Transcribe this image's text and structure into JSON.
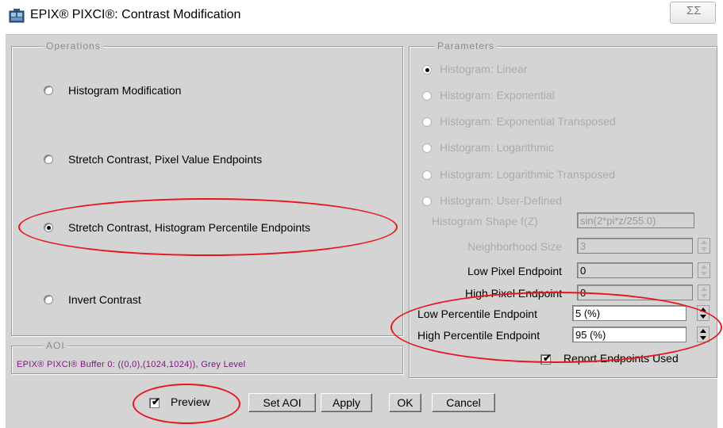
{
  "window": {
    "title": "EPIX® PIXCI®: Contrast Modification",
    "close_glyph": "☒",
    "close_symbol": "ΣΣ"
  },
  "operations": {
    "legend": "Operations",
    "options": [
      {
        "label": "Histogram Modification",
        "selected": false
      },
      {
        "label": "Stretch Contrast, Pixel Value Endpoints",
        "selected": false
      },
      {
        "label": "Stretch Contrast, Histogram Percentile Endpoints",
        "selected": true
      },
      {
        "label": "Invert Contrast",
        "selected": false
      }
    ]
  },
  "aoi": {
    "legend": "AOI",
    "text": "EPIX® PIXCI® Buffer 0: ((0,0),(1024,1024)), Grey Level"
  },
  "parameters": {
    "legend": "Parameters",
    "histogram_options": [
      {
        "label": "Histogram: Linear",
        "selected": true
      },
      {
        "label": "Histogram: Exponential",
        "selected": false
      },
      {
        "label": "Histogram: Exponential Transposed",
        "selected": false
      },
      {
        "label": "Histogram: Logarithmic",
        "selected": false
      },
      {
        "label": "Histogram: Logarithmic Transposed",
        "selected": false
      },
      {
        "label": "Histogram: User-Defined",
        "selected": false
      }
    ],
    "fields": [
      {
        "label": "Histogram Shape f(Z)",
        "value": "sin(2*pi*z/255.0)"
      },
      {
        "label": "Neighborhood Size",
        "value": "3"
      },
      {
        "label": "Low Pixel Endpoint",
        "value": "0"
      },
      {
        "label": "High Pixel Endpoint",
        "value": "0"
      },
      {
        "label": "Low Percentile Endpoint",
        "value": "5 (%)"
      },
      {
        "label": "High Percentile Endpoint",
        "value": "95 (%)"
      }
    ],
    "report_endpoints": {
      "label": "Report Endpoints Used",
      "checked": true
    }
  },
  "footer": {
    "preview": {
      "label": "Preview",
      "checked": true
    },
    "buttons": {
      "set_aoi": "Set AOI",
      "apply": "Apply",
      "ok": "OK",
      "cancel": "Cancel"
    }
  },
  "colors": {
    "annotation": "#e8141b",
    "aoi_text": "#7b1478",
    "dialog_bg": "#d4d4d4"
  },
  "icons": {
    "app": "pixci-app-icon",
    "close": "close-icon"
  }
}
